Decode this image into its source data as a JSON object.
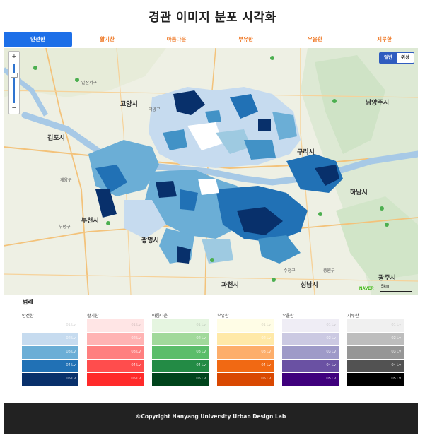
{
  "page": {
    "title": "경관 이미지 분포 시각화"
  },
  "tabs": [
    {
      "label": "안전한",
      "active": true
    },
    {
      "label": "활기찬",
      "active": false
    },
    {
      "label": "아름다운",
      "active": false
    },
    {
      "label": "부유한",
      "active": false
    },
    {
      "label": "우울한",
      "active": false
    },
    {
      "label": "지루한",
      "active": false
    }
  ],
  "map": {
    "zoom_in": "+",
    "zoom_out": "−",
    "maptype": {
      "normal": "일반",
      "satellite": "위성"
    },
    "attribution": "NAVER",
    "scale": "5km",
    "place_labels": {
      "goyang": "고양시",
      "gimpo": "김포시",
      "guri": "구리시",
      "namyangju": "남양주시",
      "hanam": "하남시",
      "bucheon": "부천시",
      "gwangmyeong": "광명시",
      "gwacheon": "과천시",
      "seongnam": "성남시",
      "gwangju": "광주시",
      "deogyang": "덕양구",
      "sujeong": "수정구",
      "jungwon": "중원구",
      "gyeyang": "계양구",
      "bupyeong": "부평구",
      "ilsan": "일산서구"
    }
  },
  "legend": {
    "title": "범례",
    "levels": [
      "01 Lv",
      "02 Lv",
      "03 Lv",
      "04 Lv",
      "05 Lv"
    ],
    "groups": [
      {
        "label": "안전한",
        "colors": [
          "#ffffff",
          "#c6dbef",
          "#6baed6",
          "#2171b5",
          "#08306b"
        ]
      },
      {
        "label": "활기찬",
        "colors": [
          "#ffe5e5",
          "#ffb3b3",
          "#ff7f7f",
          "#ff4d4d",
          "#ff2a2a"
        ]
      },
      {
        "label": "아름다운",
        "colors": [
          "#e5f5e0",
          "#a1d99b",
          "#5bbd6a",
          "#238b45",
          "#00441b"
        ]
      },
      {
        "label": "부유한",
        "colors": [
          "#fffde6",
          "#ffe9a8",
          "#fdae6b",
          "#f16913",
          "#d94801"
        ]
      },
      {
        "label": "우울한",
        "colors": [
          "#efedf5",
          "#cbc9e2",
          "#9e9ac8",
          "#6a51a3",
          "#3f007d"
        ]
      },
      {
        "label": "지루한",
        "colors": [
          "#f0f0f0",
          "#bdbdbd",
          "#969696",
          "#525252",
          "#000000"
        ]
      }
    ]
  },
  "footer": {
    "copyright": "©Copyright Hanyang University Urban Design Lab"
  }
}
